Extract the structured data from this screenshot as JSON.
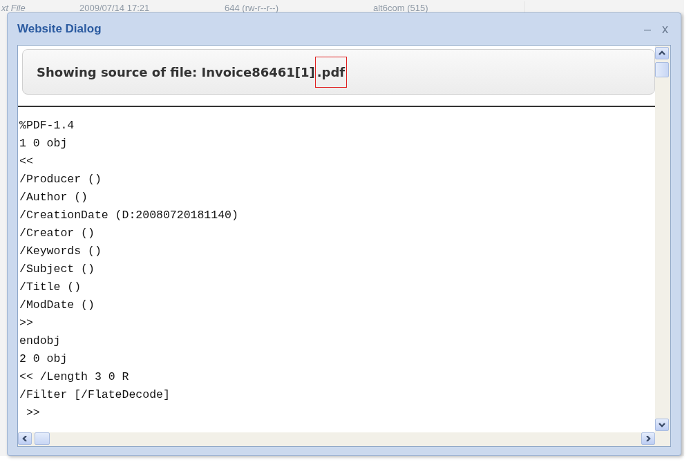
{
  "background_table": {
    "rows": [
      [
        "xt File",
        "2009/07/14 17:21",
        "644 (rw-r--r--)",
        "alt6com (515)"
      ]
    ]
  },
  "dialog": {
    "title": "Website Dialog",
    "minimize": "–",
    "close": "x",
    "heading": {
      "text": "Showing source of file: Invoice86461[1]",
      "highlighted_suffix": ".pdf"
    },
    "source_lines": [
      "%PDF-1.4",
      "1 0 obj",
      "<<",
      "/Producer ()",
      "/Author ()",
      "/CreationDate (D:20080720181140)",
      "/Creator ()",
      "/Keywords ()",
      "/Subject ()",
      "/Title ()",
      "/ModDate ()",
      ">>",
      "endobj",
      "2 0 obj",
      "<< /Length 3 0 R",
      "/Filter [/FlateDecode]",
      " >>"
    ]
  }
}
